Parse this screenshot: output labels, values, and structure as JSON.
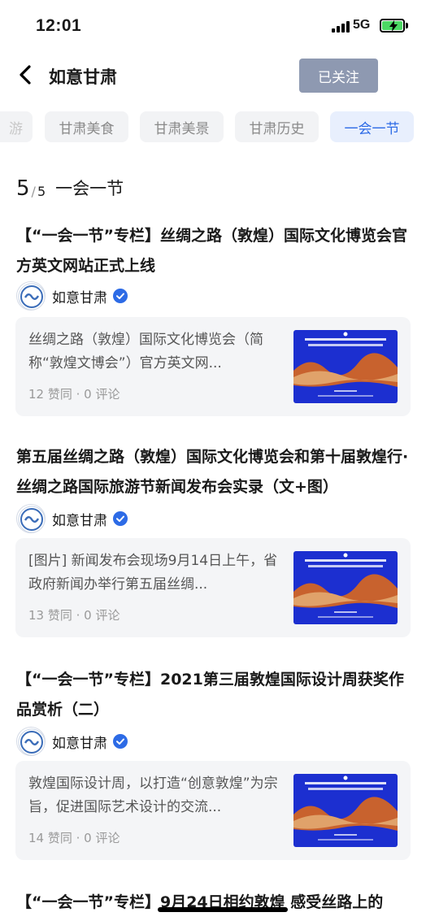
{
  "status_bar": {
    "time": "12:01",
    "network": "5G"
  },
  "header": {
    "title": "如意甘肃",
    "follow_label": "已关注"
  },
  "tabs": [
    {
      "label": "游"
    },
    {
      "label": "甘肃美食"
    },
    {
      "label": "甘肃美景"
    },
    {
      "label": "甘肃历史"
    },
    {
      "label": "一会一节",
      "active": true
    }
  ],
  "section": {
    "current": "5",
    "separator": "/",
    "total": "5",
    "title": "一会一节"
  },
  "articles": [
    {
      "title": "【“一会一节”专栏】丝绸之路（敦煌）国际文化博览会官方英文网站正式上线",
      "author": "如意甘肃",
      "summary": "丝绸之路（敦煌）国际文化博览会（简称“敦煌文博会”）官方英文网...",
      "stats": "12 赞同 · 0 评论"
    },
    {
      "title": "第五届丝绸之路（敦煌）国际文化博览会和第十届敦煌行·丝绸之路国际旅游节新闻发布会实录（文+图）",
      "author": "如意甘肃",
      "summary": "[图片] 新闻发布会现场9月14日上午，省政府新闻办举行第五届丝绸...",
      "stats": "13 赞同 · 0 评论"
    },
    {
      "title": "【“一会一节”专栏】2021第三届敦煌国际设计周获奖作品赏析（二）",
      "author": "如意甘肃",
      "summary": "敦煌国际设计周，以打造“创意敦煌”为宗旨，促进国际艺术设计的交流...",
      "stats": "14 赞同 · 0 评论"
    },
    {
      "title": "【“一会一节”专栏】9月24日相约敦煌 感受丝路上的"
    }
  ],
  "colors": {
    "accent": "#2d6be6",
    "follow_bg": "#8e99b1",
    "card_bg": "#f4f5f7",
    "thumb_blue": "#1c2fd0"
  },
  "icons": {
    "back": "chevron-left-icon",
    "verified": "verified-badge-icon",
    "battery": "battery-charging-icon",
    "signal": "signal-bars-icon"
  }
}
